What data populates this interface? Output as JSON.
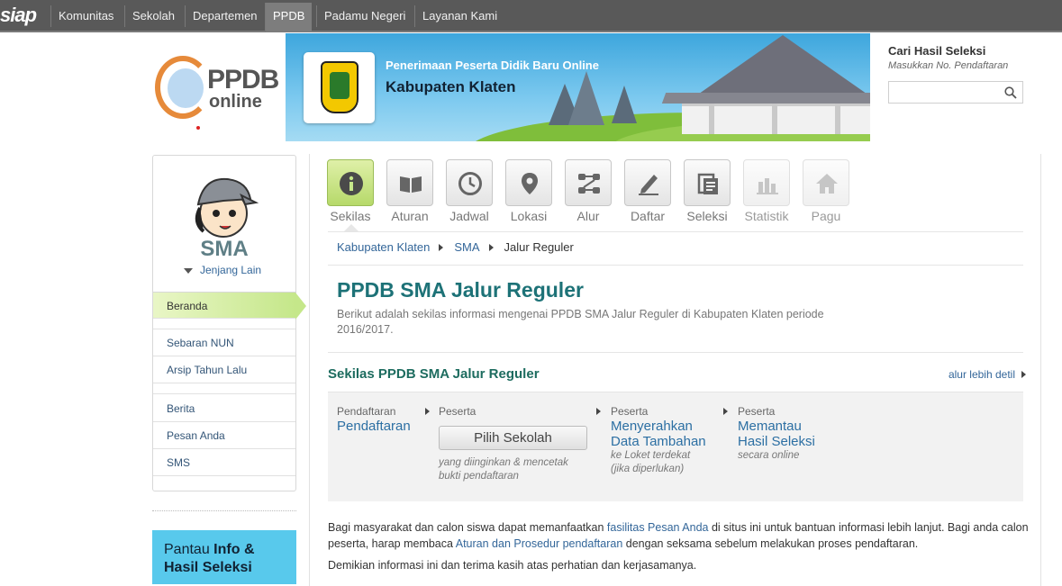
{
  "topbar": {
    "logo": "siap",
    "items": [
      "Komunitas",
      "Sekolah",
      "Departemen",
      "PPDB",
      "Padamu Negeri",
      "Layanan Kami"
    ],
    "active": "PPDB"
  },
  "brand": {
    "ppdb": "PPDB",
    "online": "online"
  },
  "banner": {
    "subtitle": "Penerimaan Peserta Didik Baru Online",
    "title": "Kabupaten Klaten"
  },
  "search": {
    "title": "Cari Hasil Seleksi",
    "hint": "Masukkan No. Pendaftaran",
    "value": "",
    "icon": "search-icon"
  },
  "sidebar": {
    "level": "SMA",
    "other_levels": "Jenjang Lain",
    "items": [
      {
        "label": "Beranda"
      },
      {
        "label": "Sebaran NUN"
      },
      {
        "label": "Arsip Tahun Lalu"
      },
      {
        "label": "Berita"
      },
      {
        "label": "Pesan Anda"
      },
      {
        "label": "SMS"
      }
    ],
    "promo_plain": "Pantau",
    "promo_bold1": "Info &",
    "promo_bold2": "Hasil Seleksi"
  },
  "menu": [
    {
      "label": "Sekilas",
      "icon": "info-icon",
      "state": "active"
    },
    {
      "label": "Aturan",
      "icon": "book-icon",
      "state": "normal"
    },
    {
      "label": "Jadwal",
      "icon": "clock-icon",
      "state": "normal"
    },
    {
      "label": "Lokasi",
      "icon": "map-pin-icon",
      "state": "normal"
    },
    {
      "label": "Alur",
      "icon": "flow-icon",
      "state": "normal"
    },
    {
      "label": "Daftar",
      "icon": "pencil-icon",
      "state": "normal"
    },
    {
      "label": "Seleksi",
      "icon": "clipboard-icon",
      "state": "normal"
    },
    {
      "label": "Statistik",
      "icon": "bar-chart-icon",
      "state": "disabled"
    },
    {
      "label": "Pagu",
      "icon": "home-icon",
      "state": "disabled"
    }
  ],
  "breadcrumb": [
    "Kabupaten Klaten",
    "SMA",
    "Jalur Reguler"
  ],
  "page": {
    "title": "PPDB SMA Jalur Reguler",
    "description": "Berikut adalah sekilas informasi mengenai PPDB SMA Jalur Reguler di Kabupaten Klaten periode 2016/2017."
  },
  "sekilas": {
    "title": "Sekilas PPDB SMA Jalur Reguler",
    "link": "alur lebih detil"
  },
  "flow": {
    "step1": {
      "caption": "Pendaftaran",
      "main": "Pendaftaran"
    },
    "step2": {
      "caption": "Peserta",
      "button": "Pilih Sekolah",
      "note1": "yang diinginkan & mencetak",
      "note2": "bukti pendaftaran"
    },
    "step3": {
      "caption": "Peserta",
      "main1": "Menyerahkan",
      "main2": "Data Tambahan",
      "note1": "ke Loket terdekat",
      "note2": "(jika diperlukan)"
    },
    "step4": {
      "caption": "Peserta",
      "main1": "Memantau",
      "main2": "Hasil Seleksi",
      "note1": "secara online"
    }
  },
  "info": {
    "p1_a": "Bagi masyarakat dan calon siswa dapat memanfaatkan ",
    "p1_link1": "fasilitas Pesan Anda",
    "p1_b": " di situs ini untuk bantuan informasi lebih lanjut. Bagi anda calon peserta, harap membaca ",
    "p1_link2": "Aturan dan Prosedur pendaftaran",
    "p1_c": " dengan seksama sebelum melakukan proses pendaftaran.",
    "p2": "Demikian informasi ini dan terima kasih atas perhatian dan kerjasamanya."
  },
  "colors": {
    "topbar": "#595959",
    "accent_green": "#b6d96a",
    "title_teal": "#1d7277",
    "link_blue": "#336699",
    "promo": "#58c9ec"
  }
}
